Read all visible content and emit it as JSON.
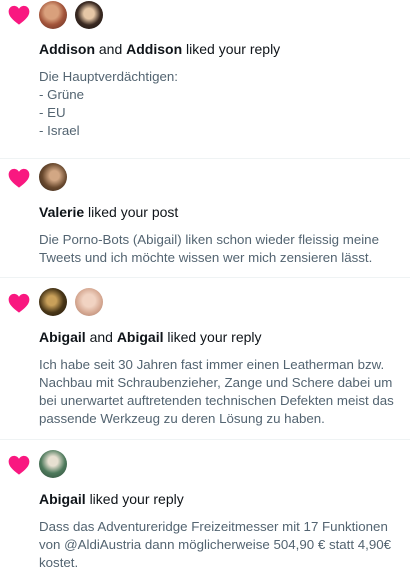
{
  "colors": {
    "heart": "#f91880",
    "muted_text": "#536471",
    "unread_background": "#f7f9f9"
  },
  "notifications": [
    {
      "icon": "heart-icon",
      "first_name": "Addison",
      "joiner": "and",
      "second_name": "Addison",
      "action": "liked your reply",
      "text": "Die Hauptverdächtigen:\n- Grüne\n- EU\n- Israel"
    },
    {
      "icon": "heart-icon",
      "first_name": "Valerie",
      "action": "liked your post",
      "text": "Die Porno-Bots (Abigail) liken schon wieder fleissig meine Tweets und ich möchte wissen wer mich zensieren lässt."
    },
    {
      "icon": "heart-icon",
      "first_name": "Abigail",
      "joiner": "and",
      "second_name": "Abigail",
      "action": "liked your reply",
      "text": "Ich habe seit 30 Jahren fast immer einen Leatherman bzw. Nachbau mit Schraubenzieher, Zange und Schere dabei um bei unerwartet auftretenden technischen Defekten meist das passende Werkzeug zu deren Lösung zu haben."
    },
    {
      "icon": "heart-icon",
      "first_name": "Abigail",
      "action": "liked your reply",
      "text": "Dass das Adventureridge Freizeitmesser mit 17 Funktionen von @AldiAustria dann möglicherweise 504,90 € statt 4,90€ kostet."
    }
  ]
}
